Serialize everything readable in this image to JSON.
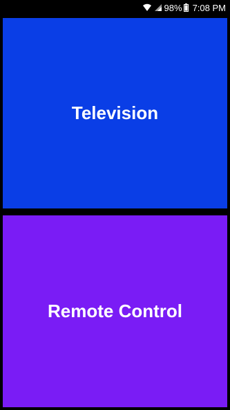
{
  "status_bar": {
    "icons": [
      "wifi-icon",
      "signal-icon",
      "battery-icon"
    ],
    "battery_percent": "98%",
    "time": "7:08 PM"
  },
  "tiles": [
    {
      "label": "Television",
      "color": "#0a3ee6"
    },
    {
      "label": "Remote Control",
      "color": "#7a1cf5"
    }
  ]
}
